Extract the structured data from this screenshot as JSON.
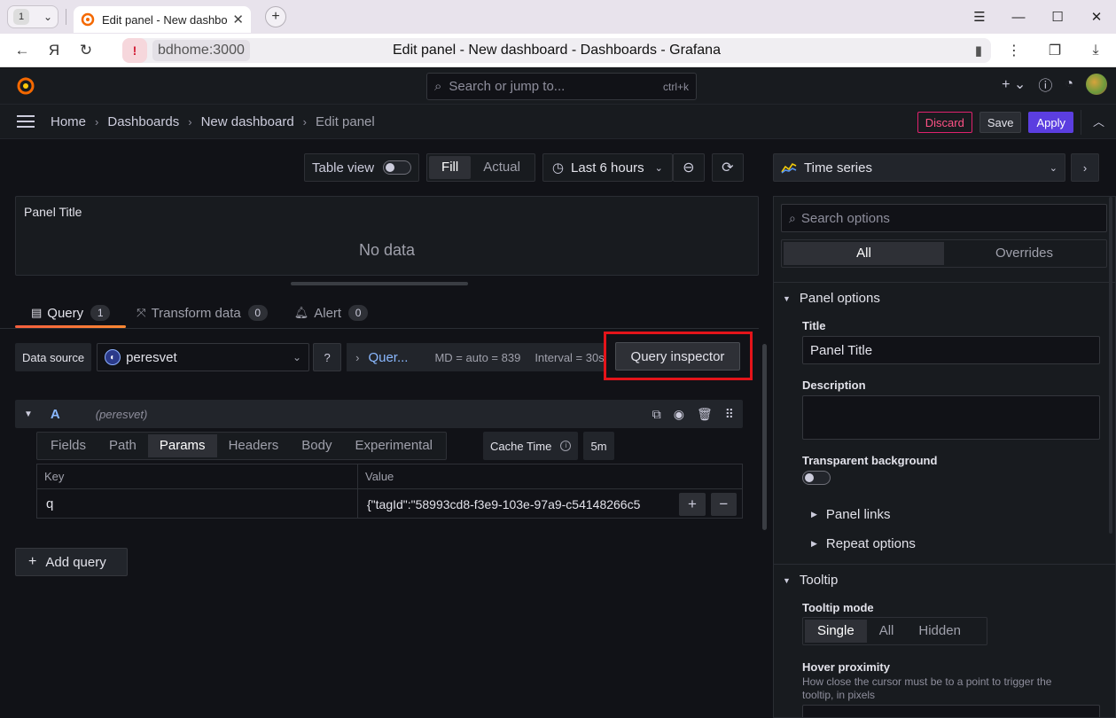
{
  "browser": {
    "tab_count": "1",
    "tab_title": "Edit panel - New dashboard - Dashboards - Grafana",
    "url_host": "bdhome:3000",
    "page_title": "Edit panel - New dashboard - Dashboards - Grafana"
  },
  "topnav": {
    "search_placeholder": "Search or jump to...",
    "search_shortcut": "ctrl+k"
  },
  "breadcrumbs": [
    "Home",
    "Dashboards",
    "New dashboard",
    "Edit panel"
  ],
  "actions": {
    "discard": "Discard",
    "save": "Save",
    "apply": "Apply"
  },
  "toolbar": {
    "table_view": "Table view",
    "fill": "Fill",
    "actual": "Actual",
    "time_range": "Last 6 hours"
  },
  "panel": {
    "title": "Panel Title",
    "no_data": "No data"
  },
  "query_tabs": [
    {
      "label": "Query",
      "count": "1"
    },
    {
      "label": "Transform data",
      "count": "0"
    },
    {
      "label": "Alert",
      "count": "0"
    }
  ],
  "datasource": {
    "label": "Data source",
    "selected": "peresvet",
    "query_options": "Quer...",
    "md": "MD = auto = 839",
    "interval": "Interval = 30s",
    "inspector": "Query inspector"
  },
  "query": {
    "ref": "A",
    "ds_name": "(peresvet)",
    "subtabs": [
      "Fields",
      "Path",
      "Params",
      "Headers",
      "Body",
      "Experimental"
    ],
    "active_subtab": "Params",
    "cache_time_label": "Cache Time",
    "cache_time_value": "5m",
    "table": {
      "headers": [
        "Key",
        "Value"
      ],
      "rows": [
        {
          "key": "q",
          "value": "{\"tagId\":\"58993cd8-f3e9-103e-97a9-c54148266c5"
        }
      ]
    },
    "add_query": "Add query"
  },
  "options": {
    "viz": "Time series",
    "search_placeholder": "Search options",
    "seg_all": "All",
    "seg_overrides": "Overrides",
    "panel_options": "Panel options",
    "title_label": "Title",
    "title_value": "Panel Title",
    "description_label": "Description",
    "transparent_label": "Transparent background",
    "panel_links": "Panel links",
    "repeat_options": "Repeat options",
    "tooltip": "Tooltip",
    "tooltip_mode_label": "Tooltip mode",
    "tooltip_modes": [
      "Single",
      "All",
      "Hidden"
    ],
    "hover_label": "Hover proximity",
    "hover_desc": "How close the cursor must be to a point to trigger the tooltip, in pixels"
  }
}
